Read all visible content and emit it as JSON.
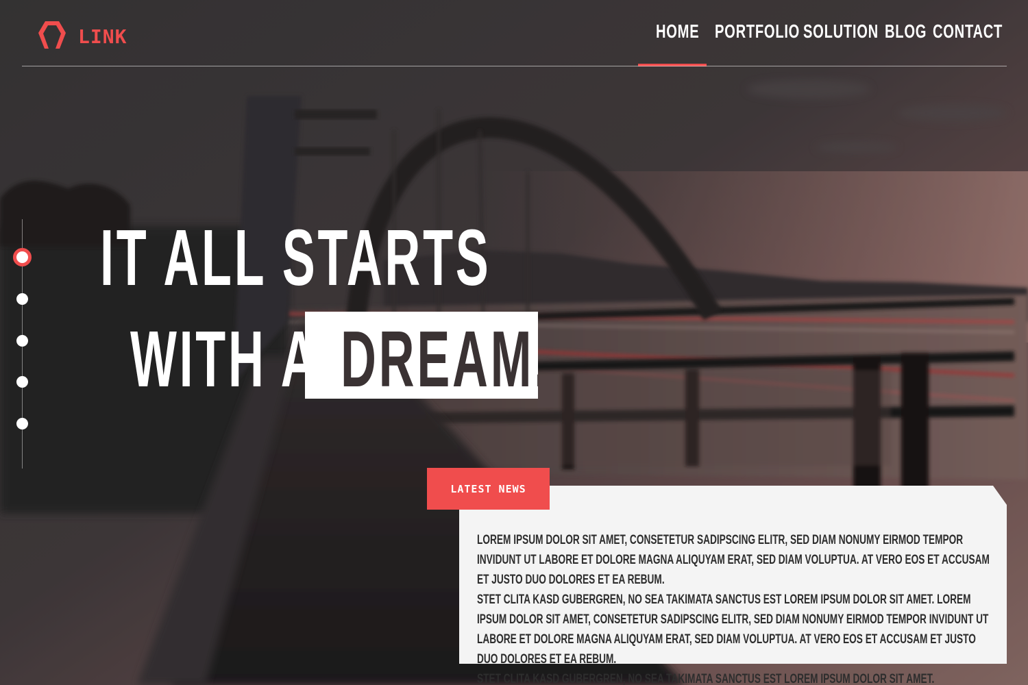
{
  "brand": {
    "name": "LINK",
    "accent_color": "#f04d4d",
    "logo_icon": "hexagon-bracket-icon"
  },
  "nav": {
    "items": [
      {
        "label": "HOME",
        "active": true
      },
      {
        "label": "PORTFOLIO",
        "active": false
      },
      {
        "label": "SOLUTION",
        "active": false
      },
      {
        "label": "BLOG",
        "active": false
      },
      {
        "label": "CONTACT",
        "active": false
      }
    ]
  },
  "slider": {
    "count": 5,
    "active_index": 0
  },
  "hero": {
    "line1": "IT ALL STARTS",
    "line2": "WITH A",
    "highlight": "DREAM."
  },
  "news": {
    "tab_label": "LATEST NEWS",
    "paragraphs": [
      "LOREM IPSUM DOLOR SIT AMET, CONSETETUR SADIPSCING ELITR, SED DIAM NONUMY EIRMOD TEMPOR INVIDUNT UT LABORE ET DOLORE MAGNA ALIQUYAM ERAT, SED DIAM VOLUPTUA. AT VERO EOS ET ACCUSAM ET JUSTO DUO DOLORES ET EA REBUM.",
      "STET CLITA KASD GUBERGREN, NO SEA TAKIMATA SANCTUS EST LOREM IPSUM DOLOR SIT AMET. LOREM IPSUM DOLOR SIT AMET, CONSETETUR SADIPSCING ELITR, SED DIAM NONUMY EIRMOD TEMPOR INVIDUNT UT LABORE ET DOLORE MAGNA ALIQUYAM ERAT, SED DIAM VOLUPTUA. AT VERO EOS ET ACCUSAM ET JUSTO DUO DOLORES ET EA REBUM.",
      "STET CLITA KASD GUBERGREN, NO SEA TAKIMATA SANCTUS EST LOREM IPSUM DOLOR SIT AMET."
    ]
  }
}
